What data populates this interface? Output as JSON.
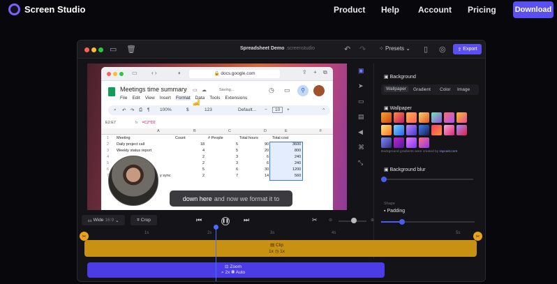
{
  "nav": {
    "brand": "Screen Studio",
    "links": [
      "Product",
      "Help",
      "Account",
      "Pricing"
    ],
    "download": "Download"
  },
  "app": {
    "title": "Spreadsheet Demo",
    "title_suffix": ".screenstudio",
    "presets": "Presets",
    "export": "Export"
  },
  "browser": {
    "url": "docs.google.com",
    "sheet_title": "Meetings time summary",
    "saving": "Saving...",
    "menu": [
      "File",
      "Edit",
      "View",
      "Insert",
      "Format",
      "Data",
      "Tools",
      "Extensions"
    ],
    "zoom": "100%",
    "font": "Default...",
    "font_size": "10",
    "cell_ref": "E2:E7",
    "formula": "=C2*D2",
    "columns": [
      "A",
      "B",
      "C",
      "D",
      "E",
      "F"
    ],
    "headers": [
      "Meeting",
      "Count",
      "# People",
      "Total hours",
      "Total cost"
    ],
    "rows": [
      [
        "Daily project call",
        "18",
        "5",
        "90",
        "3600"
      ],
      [
        "Weekly status report",
        "4",
        "5",
        "20",
        "800"
      ],
      [
        "",
        "2",
        "3",
        "6",
        "240"
      ],
      [
        "",
        "2",
        "3",
        "6",
        "240"
      ],
      [
        "",
        "5",
        "6",
        "30",
        "1200"
      ],
      [
        "y sync",
        "2",
        "7",
        "14",
        "560"
      ]
    ]
  },
  "caption": {
    "part1": "down here",
    "part2": "and",
    "part3": "now we format it to"
  },
  "panel": {
    "background_heading": "Background",
    "tabs": [
      "Wallpaper",
      "Gradient",
      "Color",
      "Image"
    ],
    "wallpaper_heading": "Wallpaper",
    "note": "Background gradients were created by",
    "note_link": "raycast.com",
    "blur_heading": "Background blur",
    "shape_heading": "Shape",
    "padding_label": "Padding"
  },
  "controls": {
    "aspect": "Wide",
    "aspect_ratio": "16:9",
    "crop": "Crop"
  },
  "timeline": {
    "ruler": [
      "1s",
      "2s",
      "3s",
      "4s",
      "5s"
    ],
    "clip_label": "Clip",
    "clip_speed": "1x",
    "clip_speed2": "1x",
    "zoom_label": "Zoom",
    "zoom_level": "2x",
    "zoom_mode": "Auto"
  },
  "colors": {
    "accent": "#5a4ff2",
    "clip": "#c99112",
    "zoom": "#4b3ce6"
  }
}
